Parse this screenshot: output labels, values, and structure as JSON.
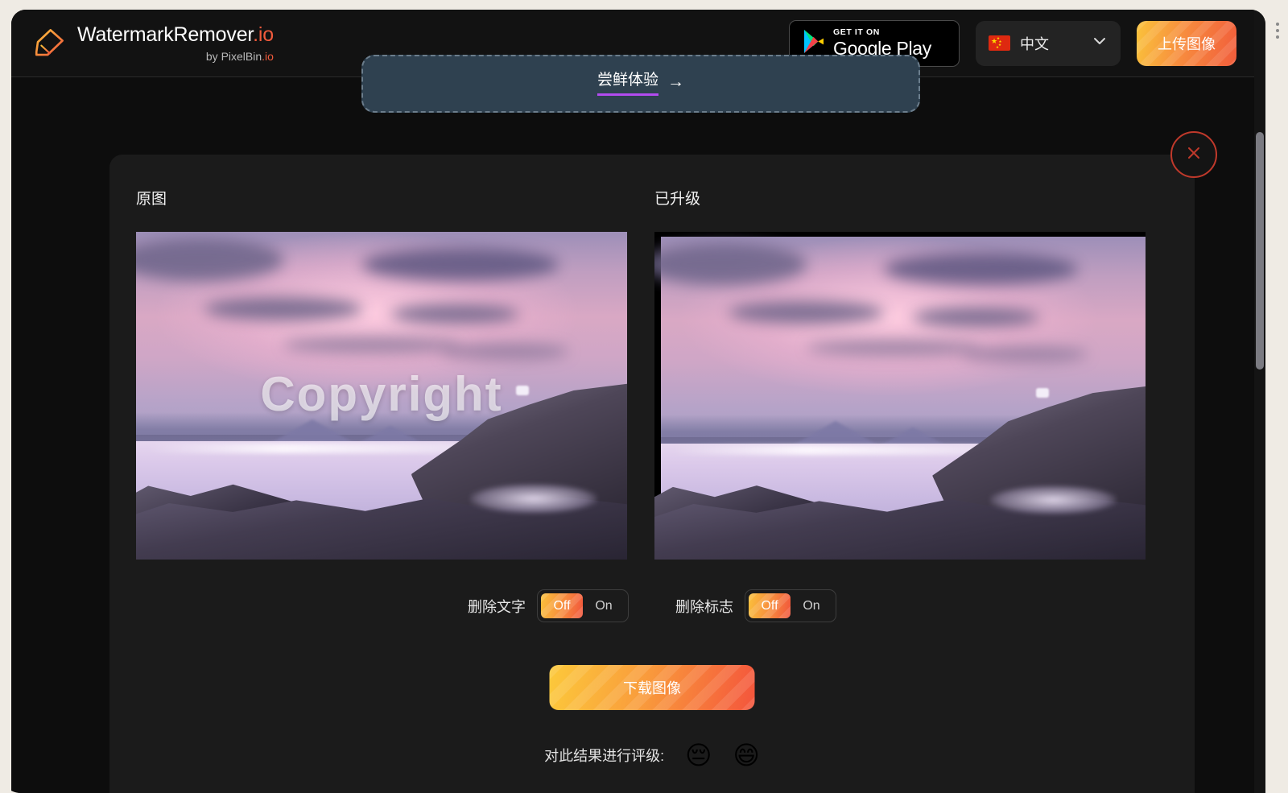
{
  "header": {
    "brand_title": "WatermarkRemover",
    "brand_title_suffix": ".io",
    "brand_sub_prefix": "by PixelBin",
    "brand_sub_suffix": ".io",
    "logo_icon": "eraser-icon",
    "google_play": {
      "small_text": "GET IT ON",
      "big_text": "Google Play",
      "icon": "google-play-triangle-icon"
    },
    "language": {
      "label": "中文",
      "flag_icon": "flag-china-icon",
      "chevron_icon": "chevron-down-icon"
    },
    "upload_button": "上传图像"
  },
  "promo_banner": {
    "link_text": "尝鲜体验",
    "arrow_icon": "arrow-right-icon"
  },
  "card": {
    "close_icon": "close-x-icon",
    "panes": [
      {
        "title": "原图",
        "watermark": "Copyright",
        "has_watermark": true
      },
      {
        "title": "已升级",
        "watermark": "",
        "has_watermark": false
      }
    ],
    "toggles": [
      {
        "label": "删除文字",
        "off_label": "Off",
        "on_label": "On",
        "selected": "Off"
      },
      {
        "label": "删除标志",
        "off_label": "Off",
        "on_label": "On",
        "selected": "Off"
      }
    ],
    "download_button": "下载图像",
    "rating": {
      "label": "对此结果进行评级:",
      "sad_emoji": "😔",
      "happy_emoji": "😄"
    }
  },
  "colors": {
    "accent_start": "#fcc93b",
    "accent_end": "#f4553c",
    "close_red": "#c0392b",
    "promo_underline": "#b34bf0",
    "banner_bg": "#2f4150",
    "page_bg": "#0d0d0d",
    "card_bg": "#1b1b1b"
  }
}
